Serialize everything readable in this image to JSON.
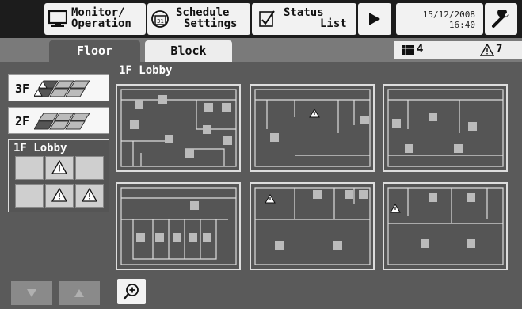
{
  "topbar": {
    "monitor_line1": "Monitor/",
    "monitor_line2": "Operation",
    "schedule_line1": "Schedule",
    "schedule_line2": "Settings",
    "calendar_number": "31",
    "status_line1": "Status",
    "status_line2": "List",
    "date": "15/12/2008",
    "time": "16:40",
    "icons": [
      "monitor-icon",
      "calendar-icon",
      "status-list-icon",
      "play-icon",
      "wrench-icon"
    ]
  },
  "tabs": {
    "floor": "Floor",
    "block": "Block"
  },
  "counts": {
    "units": "4",
    "alerts": "7"
  },
  "floors": [
    {
      "label": "3F",
      "has_alerts": true
    },
    {
      "label": "2F",
      "has_alerts": false
    }
  ],
  "current_floor": {
    "label": "1F Lobby",
    "blocks": [
      "normal",
      "alert",
      "normal",
      "normal",
      "alert",
      "alert"
    ]
  },
  "main": {
    "title": "1F Lobby"
  },
  "colors": {
    "background": "#5a5a5a",
    "top_bar": "#1c1c1c",
    "unit": "#b8b8b8"
  }
}
